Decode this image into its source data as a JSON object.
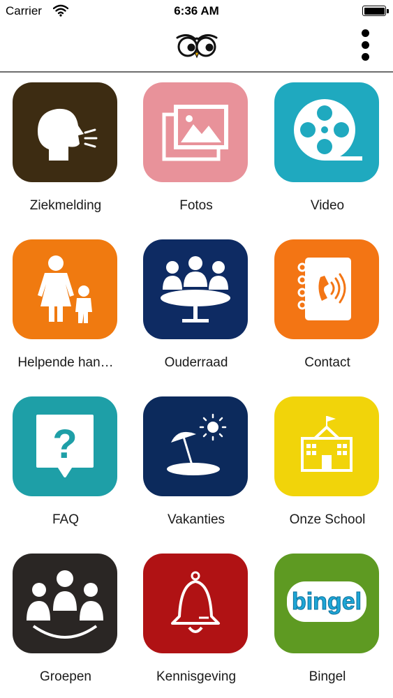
{
  "status_bar": {
    "carrier": "Carrier",
    "time": "6:36 AM",
    "battery_level": 1.0
  },
  "nav": {
    "logo_icon": "owl-eyes-icon",
    "menu_icon": "more-vertical-icon"
  },
  "tiles": [
    {
      "label": "Ziekmelding",
      "icon": "speaking-head-icon",
      "color": "#3d2c12"
    },
    {
      "label": "Fotos",
      "icon": "photos-icon",
      "color": "#e8929a"
    },
    {
      "label": "Video",
      "icon": "film-reel-icon",
      "color": "#1fa9bf"
    },
    {
      "label": "Helpende han…",
      "icon": "parent-child-icon",
      "color": "#f07a10"
    },
    {
      "label": "Ouderraad",
      "icon": "meeting-table-icon",
      "color": "#0e2b63"
    },
    {
      "label": "Contact",
      "icon": "address-book-phone-icon",
      "color": "#f37514"
    },
    {
      "label": "FAQ",
      "icon": "question-bubble-icon",
      "color": "#1e9fa7"
    },
    {
      "label": "Vakanties",
      "icon": "beach-umbrella-icon",
      "color": "#0c2a5c"
    },
    {
      "label": "Onze School",
      "icon": "school-building-icon",
      "color": "#f1d40a"
    },
    {
      "label": "Groepen",
      "icon": "group-people-icon",
      "color": "#2a2624"
    },
    {
      "label": "Kennisgeving",
      "icon": "bell-icon",
      "color": "#b01214"
    },
    {
      "label": "Bingel",
      "icon": "bingel-logo-icon",
      "color": "#5e9a22",
      "logo_text": "bingel"
    }
  ]
}
